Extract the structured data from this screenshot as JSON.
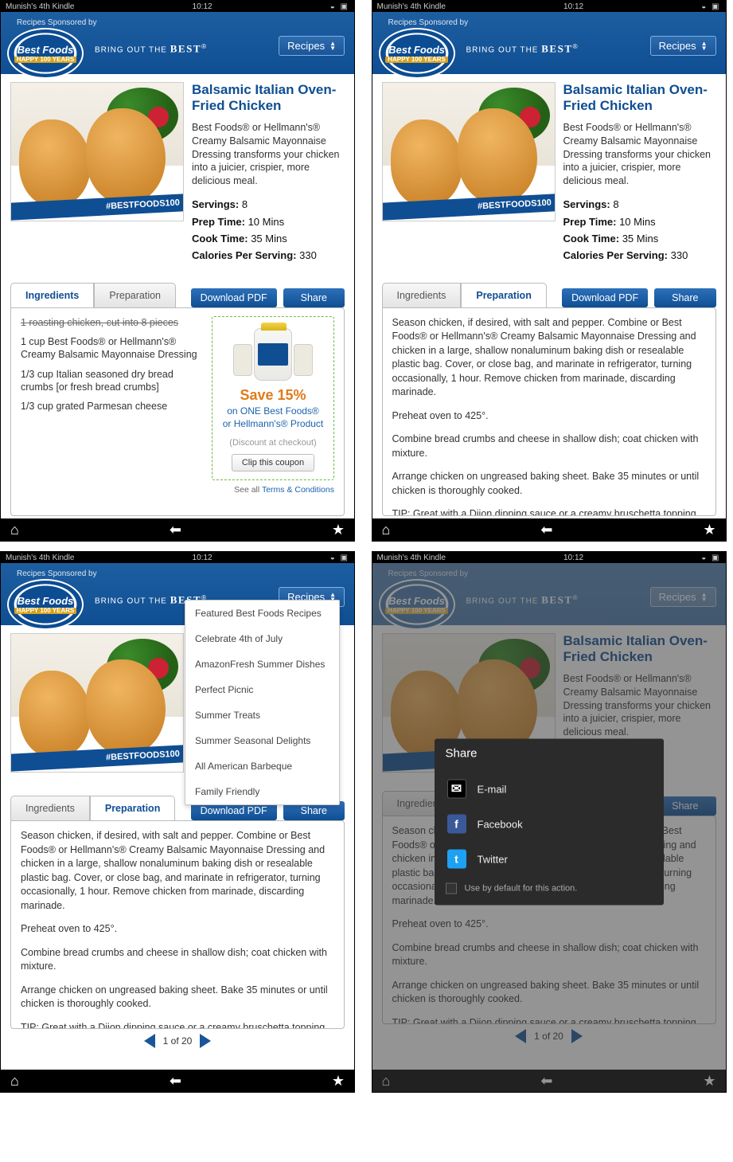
{
  "statusbar": {
    "device": "Munish's 4th Kindle",
    "time": "10:12"
  },
  "header": {
    "sponsor": "Recipes Sponsored by",
    "logo": {
      "line1": "Best Foods",
      "line2": "HAPPY",
      "line3": "100",
      "line4": "YEARS"
    },
    "tagline_pre": "BRING OUT THE",
    "tagline_bold": "BEST",
    "recipes_btn": "Recipes"
  },
  "recipe": {
    "title": "Balsamic Italian Oven-Fried Chicken",
    "description": "Best Foods® or Hellmann's® Creamy Balsamic Mayonnaise Dressing transforms your chicken into a juicier, crispier, more delicious meal.",
    "ribbon": "#BESTFOODS100",
    "meta": {
      "servings_label": "Servings:",
      "servings": "8",
      "prep_label": "Prep Time:",
      "prep": "10 Mins",
      "cook_label": "Cook Time:",
      "cook": "35 Mins",
      "cal_label": "Calories Per Serving:",
      "cal": "330"
    }
  },
  "tabs": {
    "ingredients": "Ingredients",
    "preparation": "Preparation"
  },
  "buttons": {
    "download": "Download PDF",
    "share": "Share"
  },
  "ingredients": [
    "1 roasting chicken, cut into 8 pieces",
    "1 cup Best Foods® or Hellmann's® Creamy Balsamic Mayonnaise Dressing",
    "1/3 cup Italian seasoned dry bread crumbs [or fresh bread crumbs]",
    "1/3 cup grated Parmesan cheese"
  ],
  "coupon": {
    "save": "Save 15%",
    "on1": "on ONE Best Foods®",
    "on2": "or Hellmann's® Product",
    "discount": "(Discount at checkout)",
    "clip": "Clip this coupon",
    "terms_pre": "See all",
    "terms_link": "Terms & Conditions"
  },
  "preparation": [
    "Season chicken, if desired, with salt and pepper. Combine or Best Foods® or Hellmann's® Creamy Balsamic Mayonnaise Dressing and chicken in a large, shallow nonaluminum baking dish or resealable plastic bag. Cover, or close bag, and marinate in refrigerator, turning occasionally, 1 hour. Remove chicken from marinade, discarding marinade.",
    "Preheat oven to 425°.",
    "Combine bread crumbs and cheese in shallow dish; coat chicken with mixture.",
    "Arrange chicken on ungreased baking sheet. Bake 35 minutes or until chicken is thoroughly cooked.",
    "TIP: Great with a Dijon dipping sauce or a creamy bruschetta topping. For a Dijon dipping sauce: combine 1/4 cup Hellmann's® Balsamic Mayonnaise with 2 Tbsp. milk and 1 tsp. Dijon mustard. For a creamy balsamic bruschetta topping: combine 1/4 cup Hellmann's® Balsamic Mayonnaise with 1 cup seeded and chopped tomato, 2 Tbsp chopped red onion and 1 Tbsp. thinly sliced fresh basil leaves."
  ],
  "pager": {
    "text": "1 of 20"
  },
  "dropdown": [
    "Featured Best Foods Recipes",
    "Celebrate 4th of July",
    "AmazonFresh Summer Dishes",
    "Perfect Picnic",
    "Summer Treats",
    "Summer Seasonal Delights",
    "All American Barbeque",
    "Family Friendly"
  ],
  "share": {
    "title": "Share",
    "email": "E-mail",
    "facebook": "Facebook",
    "twitter": "Twitter",
    "default": "Use by default for this action."
  }
}
